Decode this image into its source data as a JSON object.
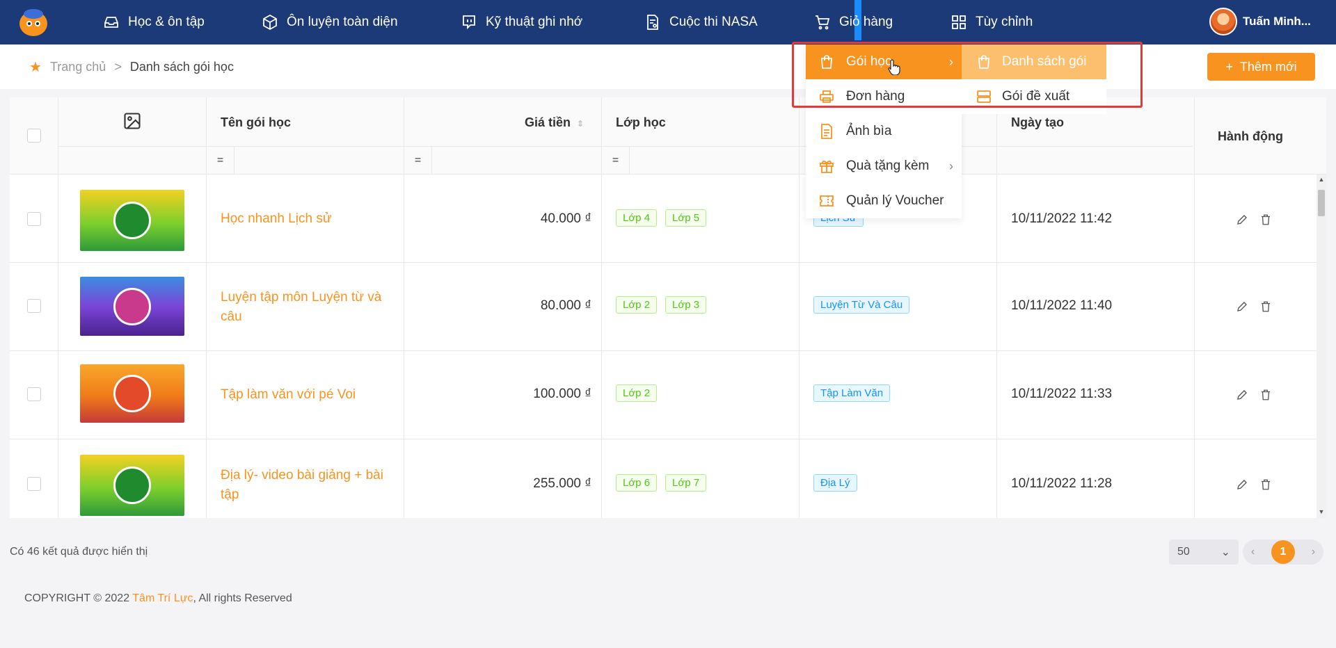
{
  "nav": {
    "items": [
      {
        "label": "Học & ôn tập",
        "icon": "inbox-icon"
      },
      {
        "label": "Ôn luyện toàn diện",
        "icon": "cube-icon"
      },
      {
        "label": "Kỹ thuật ghi nhớ",
        "icon": "chat-icon"
      },
      {
        "label": "Cuộc thi NASA",
        "icon": "document-icon"
      },
      {
        "label": "Giỏ hàng",
        "icon": "cart-icon"
      },
      {
        "label": "Tùy chỉnh",
        "icon": "grid-icon"
      }
    ],
    "user_name": "Tuấn Minh..."
  },
  "breadcrumb": {
    "home": "Trang chủ",
    "separator": ">",
    "current": "Danh sách gói học"
  },
  "add_button": {
    "icon": "+",
    "label": "Thêm mới"
  },
  "table": {
    "headers": {
      "name": "Tên gói học",
      "price": "Giá tiền",
      "class": "Lớp học",
      "created": "Ngày tạo",
      "actions": "Hành động"
    },
    "filter_symbol": "=",
    "rows": [
      {
        "name": "Học nhanh Lịch sử",
        "price": "40.000 ₫",
        "classes": [
          "Lớp 4",
          "Lớp 5"
        ],
        "subject": "Lịch Sử",
        "created": "10/11/2022 11:42",
        "thumb_color": "#4caf32"
      },
      {
        "name": "Luyện tập môn Luyện từ và câu",
        "price": "80.000 ₫",
        "classes": [
          "Lớp 2",
          "Lớp 3"
        ],
        "subject": "Luyện Từ Và Câu",
        "created": "10/11/2022 11:40",
        "thumb_color": "#6a3fc9"
      },
      {
        "name": "Tập làm văn với pé Voi",
        "price": "100.000 ₫",
        "classes": [
          "Lớp 2"
        ],
        "subject": "Tập Làm Văn",
        "created": "10/11/2022 11:33",
        "thumb_color": "#f07a18"
      },
      {
        "name": "Địa lý- video bài giảng + bài tập",
        "price": "255.000 ₫",
        "classes": [
          "Lớp 6",
          "Lớp 7"
        ],
        "subject": "Địa Lý",
        "created": "10/11/2022 11:28",
        "thumb_color": "#4caf32"
      }
    ]
  },
  "dropdown": {
    "items": [
      {
        "label": "Gói học",
        "has_submenu": true,
        "active": true
      },
      {
        "label": "Đơn hàng",
        "has_submenu": false
      },
      {
        "label": "Ảnh bìa",
        "has_submenu": false
      },
      {
        "label": "Quà tặng kèm",
        "has_submenu": true
      },
      {
        "label": "Quản lý Voucher",
        "has_submenu": false
      }
    ],
    "submenu": [
      {
        "label": "Danh sách gói",
        "active": true
      },
      {
        "label": "Gói đề xuất"
      }
    ]
  },
  "footer": {
    "result_count": "Có 46 kết quả được hiển thị",
    "page_size": "50",
    "current_page": "1",
    "copyright_prefix": "COPYRIGHT © 2022 ",
    "copyright_brand": "Tâm Trí Lực",
    "copyright_suffix": ", All rights Reserved"
  },
  "colors": {
    "nav_bg": "#1d3a78",
    "accent": "#f7931e"
  }
}
